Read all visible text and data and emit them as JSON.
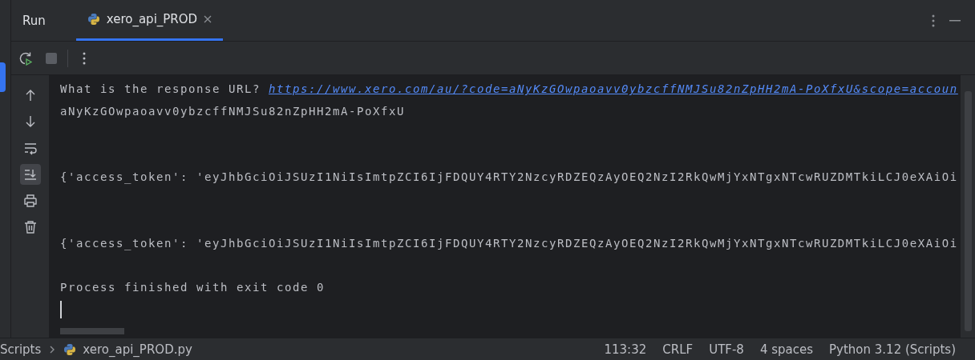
{
  "panel": {
    "title": "Run",
    "tabs": [
      {
        "label": "xero_api_PROD",
        "selected": true
      }
    ]
  },
  "toolbar": [
    {
      "kind": "rerun",
      "disabled": false
    },
    {
      "kind": "stop",
      "disabled": true
    },
    {
      "kind": "more",
      "disabled": false
    }
  ],
  "gutter": [
    {
      "kind": "up",
      "selected": false
    },
    {
      "kind": "down",
      "selected": false
    },
    {
      "kind": "wrap",
      "selected": false
    },
    {
      "kind": "scroll-end",
      "selected": true
    },
    {
      "kind": "print",
      "selected": false
    },
    {
      "kind": "trash",
      "selected": false
    }
  ],
  "console": {
    "lines": [
      {
        "kind": "prompt",
        "text": "What is the response URL? ",
        "link": "https://www.xero.com/au/?code=aNyKzGOwpaoavv0ybzcffNMJSu82nZpHH2mA-PoXfxU&scope=accoun"
      },
      {
        "kind": "output",
        "text": "aNyKzGOwpaoavv0ybzcffNMJSu82nZpHH2mA-PoXfxU"
      },
      {
        "kind": "blank"
      },
      {
        "kind": "blank"
      },
      {
        "kind": "output",
        "text": "{'access_token': 'eyJhbGciOiJSUzI1NiIsImtpZCI6IjFDQUY4RTY2NzcyRDZEQzAyOEQ2NzI2RkQwMjYxNTgxNTcwRUZDMTkiLCJ0eXAiOi"
      },
      {
        "kind": "blank"
      },
      {
        "kind": "blank"
      },
      {
        "kind": "output",
        "text": "{'access_token': 'eyJhbGciOiJSUzI1NiIsImtpZCI6IjFDQUY4RTY2NzcyRDZEQzAyOEQ2NzI2RkQwMjYxNTgxNTcwRUZDMTkiLCJ0eXAiOi"
      },
      {
        "kind": "blank"
      },
      {
        "kind": "output",
        "text": "Process finished with exit code 0"
      },
      {
        "kind": "cursor"
      }
    ]
  },
  "status_bar": {
    "breadcrumbs": [
      {
        "kind": "folder",
        "label": "Scripts"
      },
      {
        "kind": "file",
        "label": "xero_api_PROD.py"
      }
    ],
    "items": [
      "113:32",
      "CRLF",
      "UTF-8",
      "4 spaces",
      "Python 3.12 (Scripts)"
    ]
  }
}
